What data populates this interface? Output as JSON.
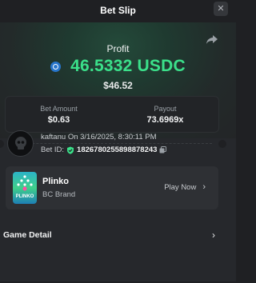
{
  "header": {
    "title": "Bet Slip",
    "close_glyph": "✕"
  },
  "profit": {
    "label": "Profit",
    "value": "46.5332 USDC",
    "fiat": "$46.52",
    "currency_icon": "usdc-coin-icon",
    "value_color": "#3be08a"
  },
  "stats": {
    "bet_amount_label": "Bet Amount",
    "bet_amount_value": "$0.63",
    "payout_label": "Payout",
    "payout_value": "73.6969x"
  },
  "bet": {
    "username": "kaftanu",
    "on_text": "On 3/16/2025, 8:30:11 PM",
    "bet_id_label": "Bet ID:",
    "bet_id": "1826780255898878243"
  },
  "game": {
    "name": "Plinko",
    "brand": "BC Brand",
    "thumb_text": "PLINKO",
    "play_label": "Play Now"
  },
  "footer": {
    "game_detail_label": "Game Detail"
  },
  "icons": {
    "share": "share-icon",
    "close": "close-icon",
    "shield": "shield-check-icon",
    "copy": "copy-icon",
    "chevron": "chevron-right-icon"
  }
}
